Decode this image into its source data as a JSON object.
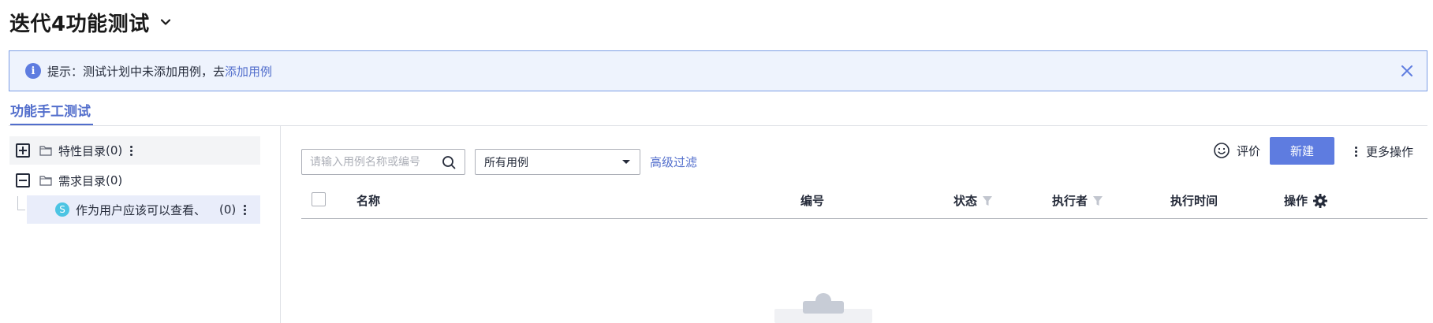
{
  "header": {
    "title": "迭代4功能测试",
    "title_dropdown_icon": "chevron-down-icon"
  },
  "alert": {
    "icon": "info-icon",
    "icon_glyph": "i",
    "prefix": "提示：测试计划中未添加用例，去",
    "link": "添加用例",
    "close_icon": "close-icon"
  },
  "tabs": [
    {
      "label": "功能手工测试",
      "active": true
    }
  ],
  "tree": {
    "items": [
      {
        "label": "特性目录",
        "count": "(0)",
        "toggle": "expand-icon",
        "icon": "folder-icon"
      },
      {
        "label": "需求目录",
        "count": "(0)",
        "toggle": "collapse-icon",
        "icon": "folder-icon"
      }
    ],
    "child": {
      "badge": "S",
      "label": "作为用户应该可以查看、…",
      "count": "(0)"
    }
  },
  "toolbar": {
    "search_placeholder": "请输入用例名称或编号",
    "filter_select_value": "所有用例",
    "advanced_filter": "高级过滤",
    "rate_label": "评价",
    "new_button": "新建",
    "more_label": "更多操作"
  },
  "table": {
    "columns": [
      "名称",
      "编号",
      "状态",
      "执行者",
      "执行时间",
      "操作"
    ]
  },
  "colors": {
    "accent": "#5e7ce0",
    "link": "#526ecc",
    "alert_bg": "#eef3fd",
    "alert_border": "#7d9ee5",
    "story_badge": "#4cc4e3"
  }
}
